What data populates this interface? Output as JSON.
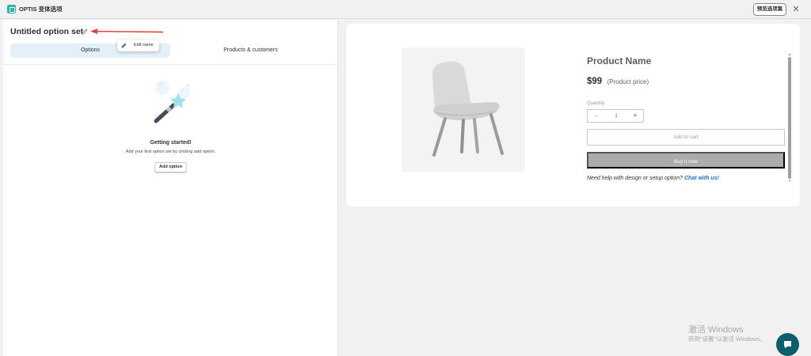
{
  "window": {
    "title": "OPTIS 变体选项",
    "save_button": "预览选项集",
    "close_icon": "close-icon"
  },
  "editor": {
    "set_name": "Untitled option set",
    "edit_tooltip": "Edit name",
    "tabs": [
      {
        "label": "Options",
        "selected": true
      },
      {
        "label": "Products & customers",
        "selected": false
      }
    ],
    "empty_state": {
      "title": "Getting started!",
      "subtitle": "Add your first option set by clicking add option.",
      "button": "Add option"
    }
  },
  "preview": {
    "product_name": "Product Name",
    "price": "$99",
    "price_note": "(Product price)",
    "quantity_label": "Quantity",
    "quantity_minus": "-",
    "quantity_value": "1",
    "quantity_plus": "+",
    "add_to_cart": "Add to cart",
    "buy_now": "Buy it now",
    "help_text": "Need help with design or setup option?",
    "help_link": "Chat with us!"
  },
  "watermark": {
    "title": "激活 Windows",
    "subtitle": "转到\"设置\"以激活 Windows。"
  },
  "colors": {
    "accent_tab": "#e3f0fa",
    "link": "#1f6fd1",
    "buy_now": "#ababab",
    "chat_bubble": "#0b5e6c",
    "annotation_arrow": "#e53935"
  }
}
